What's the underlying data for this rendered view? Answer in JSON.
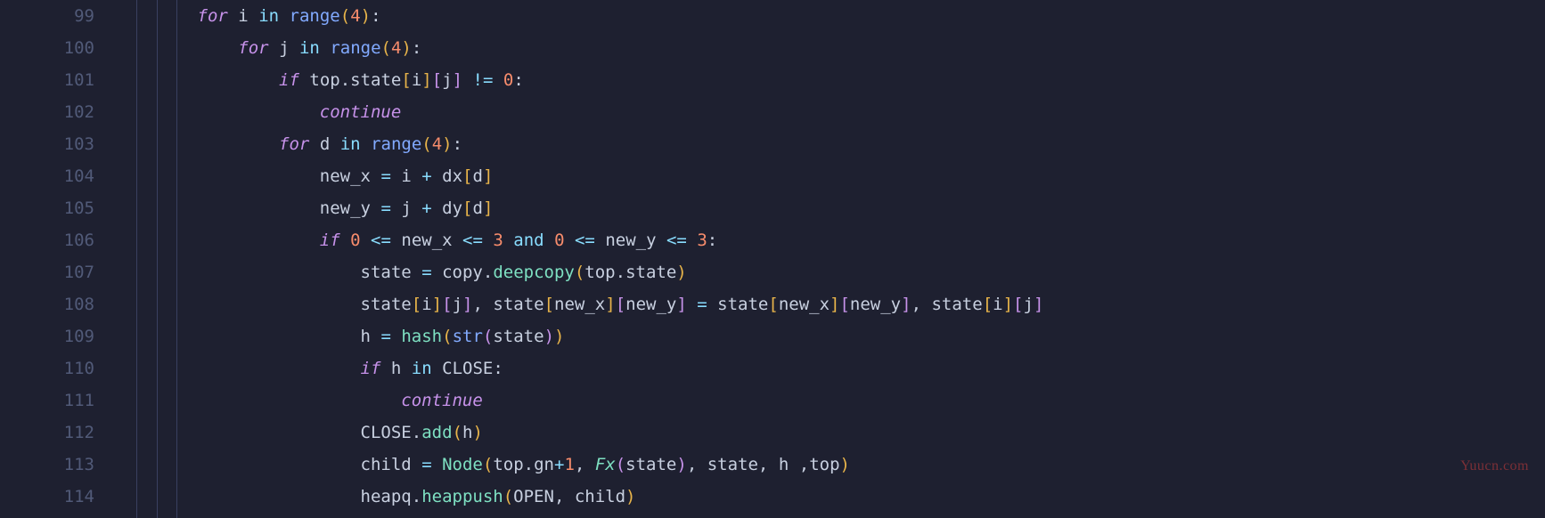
{
  "watermark": "Yuucn.com",
  "lines": [
    {
      "num": "99",
      "indent": 8,
      "tokens": [
        [
          "kw",
          "for"
        ],
        [
          "sp",
          " "
        ],
        [
          "var",
          "i"
        ],
        [
          "sp",
          " "
        ],
        [
          "op",
          "in"
        ],
        [
          "sp",
          " "
        ],
        [
          "builtin",
          "range"
        ],
        [
          "punc",
          "("
        ],
        [
          "num",
          "4"
        ],
        [
          "punc",
          ")"
        ],
        [
          "white",
          ":"
        ]
      ]
    },
    {
      "num": "100",
      "indent": 12,
      "tokens": [
        [
          "kw",
          "for"
        ],
        [
          "sp",
          " "
        ],
        [
          "var",
          "j"
        ],
        [
          "sp",
          " "
        ],
        [
          "op",
          "in"
        ],
        [
          "sp",
          " "
        ],
        [
          "builtin",
          "range"
        ],
        [
          "punc",
          "("
        ],
        [
          "num",
          "4"
        ],
        [
          "punc",
          ")"
        ],
        [
          "white",
          ":"
        ]
      ]
    },
    {
      "num": "101",
      "indent": 16,
      "tokens": [
        [
          "kw",
          "if"
        ],
        [
          "sp",
          " "
        ],
        [
          "var",
          "top"
        ],
        [
          "white",
          "."
        ],
        [
          "var",
          "state"
        ],
        [
          "punc",
          "["
        ],
        [
          "var",
          "i"
        ],
        [
          "punc",
          "]"
        ],
        [
          "punc2",
          "["
        ],
        [
          "var",
          "j"
        ],
        [
          "punc2",
          "]"
        ],
        [
          "sp",
          " "
        ],
        [
          "op",
          "!="
        ],
        [
          "sp",
          " "
        ],
        [
          "num",
          "0"
        ],
        [
          "white",
          ":"
        ]
      ]
    },
    {
      "num": "102",
      "indent": 20,
      "tokens": [
        [
          "ctrl",
          "continue"
        ]
      ]
    },
    {
      "num": "103",
      "indent": 16,
      "tokens": [
        [
          "kw",
          "for"
        ],
        [
          "sp",
          " "
        ],
        [
          "var",
          "d"
        ],
        [
          "sp",
          " "
        ],
        [
          "op",
          "in"
        ],
        [
          "sp",
          " "
        ],
        [
          "builtin",
          "range"
        ],
        [
          "punc",
          "("
        ],
        [
          "num",
          "4"
        ],
        [
          "punc",
          ")"
        ],
        [
          "white",
          ":"
        ]
      ]
    },
    {
      "num": "104",
      "indent": 20,
      "tokens": [
        [
          "var",
          "new_x"
        ],
        [
          "sp",
          " "
        ],
        [
          "op",
          "="
        ],
        [
          "sp",
          " "
        ],
        [
          "var",
          "i"
        ],
        [
          "sp",
          " "
        ],
        [
          "op",
          "+"
        ],
        [
          "sp",
          " "
        ],
        [
          "var",
          "dx"
        ],
        [
          "punc",
          "["
        ],
        [
          "var",
          "d"
        ],
        [
          "punc",
          "]"
        ]
      ]
    },
    {
      "num": "105",
      "indent": 20,
      "tokens": [
        [
          "var",
          "new_y"
        ],
        [
          "sp",
          " "
        ],
        [
          "op",
          "="
        ],
        [
          "sp",
          " "
        ],
        [
          "var",
          "j"
        ],
        [
          "sp",
          " "
        ],
        [
          "op",
          "+"
        ],
        [
          "sp",
          " "
        ],
        [
          "var",
          "dy"
        ],
        [
          "punc",
          "["
        ],
        [
          "var",
          "d"
        ],
        [
          "punc",
          "]"
        ]
      ]
    },
    {
      "num": "106",
      "indent": 20,
      "tokens": [
        [
          "kw",
          "if"
        ],
        [
          "sp",
          " "
        ],
        [
          "num",
          "0"
        ],
        [
          "sp",
          " "
        ],
        [
          "op",
          "<="
        ],
        [
          "sp",
          " "
        ],
        [
          "var",
          "new_x"
        ],
        [
          "sp",
          " "
        ],
        [
          "op",
          "<="
        ],
        [
          "sp",
          " "
        ],
        [
          "num",
          "3"
        ],
        [
          "sp",
          " "
        ],
        [
          "op",
          "and"
        ],
        [
          "sp",
          " "
        ],
        [
          "num",
          "0"
        ],
        [
          "sp",
          " "
        ],
        [
          "op",
          "<="
        ],
        [
          "sp",
          " "
        ],
        [
          "var",
          "new_y"
        ],
        [
          "sp",
          " "
        ],
        [
          "op",
          "<="
        ],
        [
          "sp",
          " "
        ],
        [
          "num",
          "3"
        ],
        [
          "white",
          ":"
        ]
      ]
    },
    {
      "num": "107",
      "indent": 24,
      "tokens": [
        [
          "var",
          "state"
        ],
        [
          "sp",
          " "
        ],
        [
          "op",
          "="
        ],
        [
          "sp",
          " "
        ],
        [
          "var",
          "copy"
        ],
        [
          "white",
          "."
        ],
        [
          "call",
          "deepcopy"
        ],
        [
          "punc",
          "("
        ],
        [
          "var",
          "top"
        ],
        [
          "white",
          "."
        ],
        [
          "var",
          "state"
        ],
        [
          "punc",
          ")"
        ]
      ]
    },
    {
      "num": "108",
      "indent": 24,
      "tokens": [
        [
          "var",
          "state"
        ],
        [
          "punc",
          "["
        ],
        [
          "var",
          "i"
        ],
        [
          "punc",
          "]"
        ],
        [
          "punc2",
          "["
        ],
        [
          "var",
          "j"
        ],
        [
          "punc2",
          "]"
        ],
        [
          "white",
          ","
        ],
        [
          "sp",
          " "
        ],
        [
          "var",
          "state"
        ],
        [
          "punc",
          "["
        ],
        [
          "var",
          "new_x"
        ],
        [
          "punc",
          "]"
        ],
        [
          "punc2",
          "["
        ],
        [
          "var",
          "new_y"
        ],
        [
          "punc2",
          "]"
        ],
        [
          "sp",
          " "
        ],
        [
          "op",
          "="
        ],
        [
          "sp",
          " "
        ],
        [
          "var",
          "state"
        ],
        [
          "punc",
          "["
        ],
        [
          "var",
          "new_x"
        ],
        [
          "punc",
          "]"
        ],
        [
          "punc2",
          "["
        ],
        [
          "var",
          "new_y"
        ],
        [
          "punc2",
          "]"
        ],
        [
          "white",
          ","
        ],
        [
          "sp",
          " "
        ],
        [
          "var",
          "state"
        ],
        [
          "punc",
          "["
        ],
        [
          "var",
          "i"
        ],
        [
          "punc",
          "]"
        ],
        [
          "punc2",
          "["
        ],
        [
          "var",
          "j"
        ],
        [
          "punc2",
          "]"
        ]
      ]
    },
    {
      "num": "109",
      "indent": 24,
      "tokens": [
        [
          "var",
          "h"
        ],
        [
          "sp",
          " "
        ],
        [
          "op",
          "="
        ],
        [
          "sp",
          " "
        ],
        [
          "call",
          "hash"
        ],
        [
          "punc",
          "("
        ],
        [
          "builtin",
          "str"
        ],
        [
          "punc2",
          "("
        ],
        [
          "var",
          "state"
        ],
        [
          "punc2",
          ")"
        ],
        [
          "punc",
          ")"
        ]
      ]
    },
    {
      "num": "110",
      "indent": 24,
      "tokens": [
        [
          "kw",
          "if"
        ],
        [
          "sp",
          " "
        ],
        [
          "var",
          "h"
        ],
        [
          "sp",
          " "
        ],
        [
          "op",
          "in"
        ],
        [
          "sp",
          " "
        ],
        [
          "var",
          "CLOSE"
        ],
        [
          "white",
          ":"
        ]
      ]
    },
    {
      "num": "111",
      "indent": 28,
      "tokens": [
        [
          "ctrl",
          "continue"
        ]
      ]
    },
    {
      "num": "112",
      "indent": 24,
      "tokens": [
        [
          "var",
          "CLOSE"
        ],
        [
          "white",
          "."
        ],
        [
          "call",
          "add"
        ],
        [
          "punc",
          "("
        ],
        [
          "var",
          "h"
        ],
        [
          "punc",
          ")"
        ]
      ]
    },
    {
      "num": "113",
      "indent": 24,
      "tokens": [
        [
          "var",
          "child"
        ],
        [
          "sp",
          " "
        ],
        [
          "op",
          "="
        ],
        [
          "sp",
          " "
        ],
        [
          "call",
          "Node"
        ],
        [
          "punc",
          "("
        ],
        [
          "var",
          "top"
        ],
        [
          "white",
          "."
        ],
        [
          "var",
          "gn"
        ],
        [
          "op",
          "+"
        ],
        [
          "num",
          "1"
        ],
        [
          "white",
          ","
        ],
        [
          "sp",
          " "
        ],
        [
          "callit",
          "Fx"
        ],
        [
          "punc2",
          "("
        ],
        [
          "var",
          "state"
        ],
        [
          "punc2",
          ")"
        ],
        [
          "white",
          ","
        ],
        [
          "sp",
          " "
        ],
        [
          "var",
          "state"
        ],
        [
          "white",
          ","
        ],
        [
          "sp",
          " "
        ],
        [
          "var",
          "h"
        ],
        [
          "sp",
          " "
        ],
        [
          "white",
          ","
        ],
        [
          "var",
          "top"
        ],
        [
          "punc",
          ")"
        ]
      ]
    },
    {
      "num": "114",
      "indent": 24,
      "tokens": [
        [
          "var",
          "heapq"
        ],
        [
          "white",
          "."
        ],
        [
          "call",
          "heappush"
        ],
        [
          "punc",
          "("
        ],
        [
          "var",
          "OPEN"
        ],
        [
          "white",
          ","
        ],
        [
          "sp",
          " "
        ],
        [
          "var",
          "child"
        ],
        [
          "punc",
          ")"
        ]
      ]
    }
  ],
  "indent_guide_cols": [
    2,
    4,
    6
  ]
}
